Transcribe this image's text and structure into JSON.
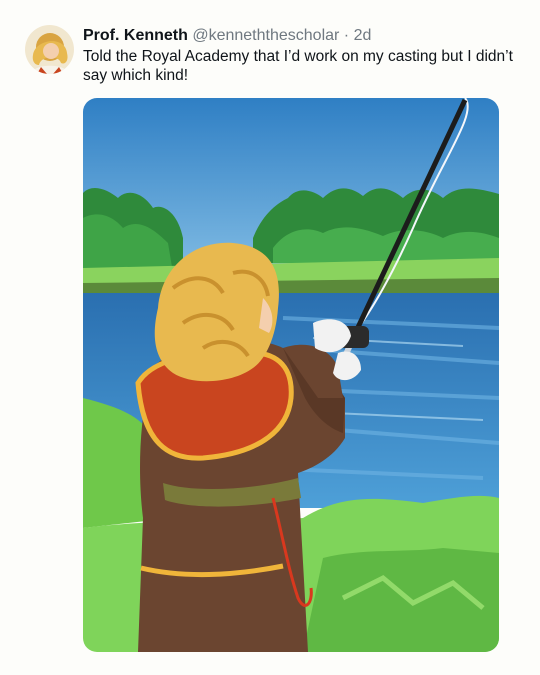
{
  "tweet": {
    "author": {
      "display_name": "Prof. Kenneth",
      "handle": "@kenneththescholar"
    },
    "separator": "·",
    "timestamp": "2d",
    "text": "Told the Royal Academy that I’d work on my casting but I didn’t say which kind!",
    "media": {
      "type": "illustration",
      "description_colors": {
        "sky": "#4a9bd6",
        "water": "#3f88c8",
        "grass": "#7fd45a",
        "robe": "#6b4530",
        "hair": "#e8b94f",
        "trim": "#c9451f"
      }
    }
  }
}
